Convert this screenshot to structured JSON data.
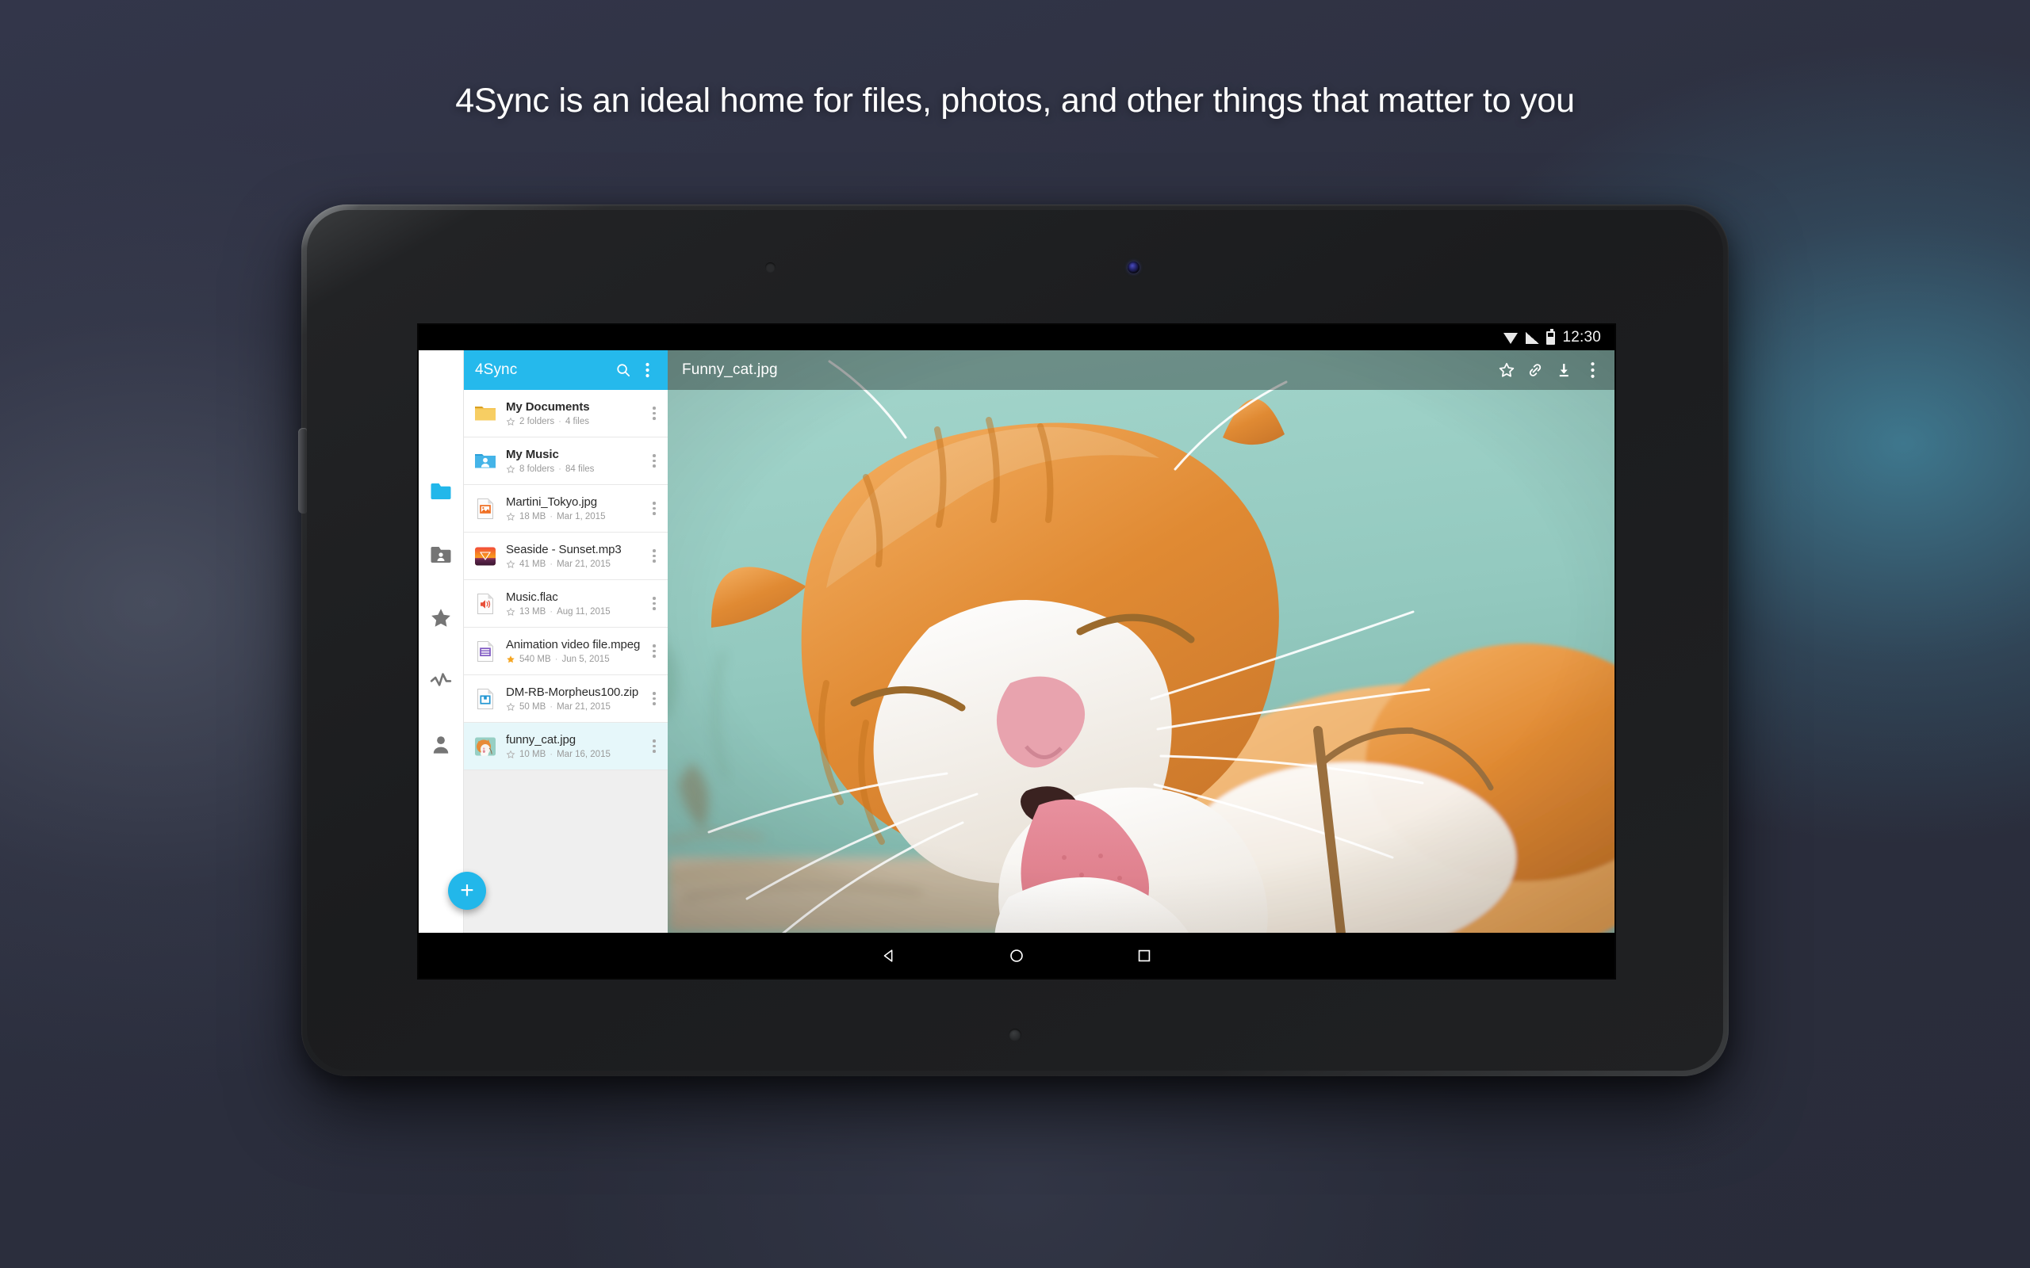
{
  "headline": "4Sync is an ideal home for files, photos, and other things that matter to you",
  "colors": {
    "accent": "#25b9ec",
    "fab": "#22b7ea",
    "selected_row": "#e6f7fa",
    "star_active": "#f5a623",
    "page_background": "#2e3140"
  },
  "statusbar": {
    "time": "12:30",
    "icons": [
      "wifi-icon",
      "signal-icon",
      "battery-icon"
    ]
  },
  "navrail": {
    "items": [
      {
        "name": "my-files",
        "icon": "folder-icon",
        "active": true
      },
      {
        "name": "shared",
        "icon": "shared-folder-icon",
        "active": false
      },
      {
        "name": "favorites",
        "icon": "star-icon",
        "active": false
      },
      {
        "name": "activity",
        "icon": "activity-pulse-icon",
        "active": false
      },
      {
        "name": "account",
        "icon": "person-icon",
        "active": false
      }
    ]
  },
  "appbar": {
    "title": "4Sync",
    "search_icon": "search-icon",
    "overflow_icon": "overflow-menu-icon"
  },
  "fab": {
    "label": "+",
    "icon": "plus-icon"
  },
  "filelist": [
    {
      "name": "My Documents",
      "bold": true,
      "starred": false,
      "meta1": "2 folders",
      "meta2": "4 files",
      "icon": "folder-yellow-icon",
      "selected": false
    },
    {
      "name": "My Music",
      "bold": true,
      "starred": false,
      "meta1": "8 folders",
      "meta2": "84 files",
      "icon": "folder-shared-blue-icon",
      "selected": false
    },
    {
      "name": "Martini_Tokyo.jpg",
      "bold": false,
      "starred": false,
      "meta1": "18 MB",
      "meta2": "Mar 1, 2015",
      "icon": "file-image-icon",
      "selected": false
    },
    {
      "name": "Seaside - Sunset.mp3",
      "bold": false,
      "starred": false,
      "meta1": "41 MB",
      "meta2": "Mar 21, 2015",
      "icon": "album-art-sunset-icon",
      "selected": false
    },
    {
      "name": "Music.flac",
      "bold": false,
      "starred": false,
      "meta1": "13 MB",
      "meta2": "Aug 11, 2015",
      "icon": "file-audio-icon",
      "selected": false
    },
    {
      "name": "Animation video file.mpeg",
      "bold": false,
      "starred": true,
      "meta1": "540 MB",
      "meta2": "Jun 5, 2015",
      "icon": "file-video-icon",
      "selected": false
    },
    {
      "name": "DM-RB-Morpheus100.zip",
      "bold": false,
      "starred": false,
      "meta1": "50 MB",
      "meta2": "Mar 21, 2015",
      "icon": "file-archive-icon",
      "selected": false
    },
    {
      "name": "funny_cat.jpg",
      "bold": false,
      "starred": false,
      "meta1": "10 MB",
      "meta2": "Mar 16, 2015",
      "icon": "photo-thumbnail-cat-icon",
      "selected": true
    }
  ],
  "preview": {
    "title": "Funny_cat.jpg",
    "image_description": "orange and white cat licking its paw on mint green background",
    "actions": [
      {
        "name": "favorite",
        "icon": "star-outline-icon"
      },
      {
        "name": "share-link",
        "icon": "link-icon"
      },
      {
        "name": "download",
        "icon": "download-icon"
      },
      {
        "name": "more",
        "icon": "overflow-menu-icon"
      }
    ]
  },
  "navbar": {
    "buttons": [
      {
        "name": "back",
        "icon": "triangle-back-icon"
      },
      {
        "name": "home",
        "icon": "circle-home-icon"
      },
      {
        "name": "recents",
        "icon": "square-recents-icon"
      }
    ]
  }
}
